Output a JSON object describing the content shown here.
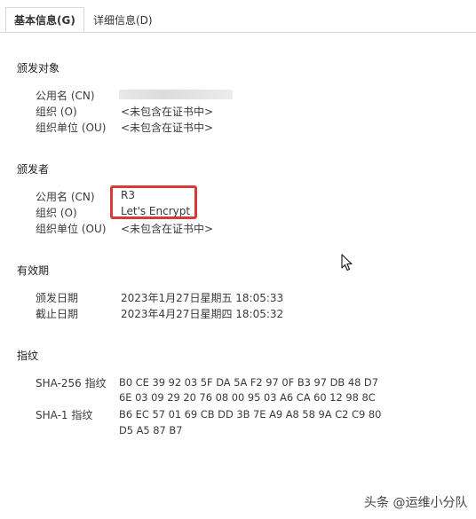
{
  "tabs": [
    {
      "label": "基本信息(G)",
      "active": true
    },
    {
      "label": "详细信息(D)",
      "active": false
    }
  ],
  "subject": {
    "heading": "颁发对象",
    "cn_label": "公用名 (CN)",
    "cn_value": "",
    "o_label": "组织 (O)",
    "o_value": "<未包含在证书中>",
    "ou_label": "组织单位 (OU)",
    "ou_value": "<未包含在证书中>"
  },
  "issuer": {
    "heading": "颁发者",
    "cn_label": "公用名 (CN)",
    "cn_value": "R3",
    "o_label": "组织 (O)",
    "o_value": "Let's Encrypt",
    "ou_label": "组织单位 (OU)",
    "ou_value": "<未包含在证书中>"
  },
  "validity": {
    "heading": "有效期",
    "issued_label": "颁发日期",
    "issued_value": "2023年1月27日星期五 18:05:33",
    "expires_label": "截止日期",
    "expires_value": "2023年4月27日星期四 18:05:32"
  },
  "fingerprints": {
    "heading": "指纹",
    "sha256_label": "SHA-256 指纹",
    "sha256_line1": "B0 CE 39 92 03 5F DA 5A F2 97 0F B3 97 DB 48 D7",
    "sha256_line2": "6E 03 09 29 20 76 08 00 95 03 A6 CA 60 12 98 8C",
    "sha1_label": "SHA-1 指纹",
    "sha1_line1": "B6 EC 57 01 69 CB DD 3B 7E A9 A8 58 9A C2 C9 80",
    "sha1_line2": "D5 A5 87 B7"
  },
  "watermark": "头条 @运维小分队",
  "colors": {
    "highlight": "#d83a3a",
    "tab_border": "#d9d9d9"
  }
}
